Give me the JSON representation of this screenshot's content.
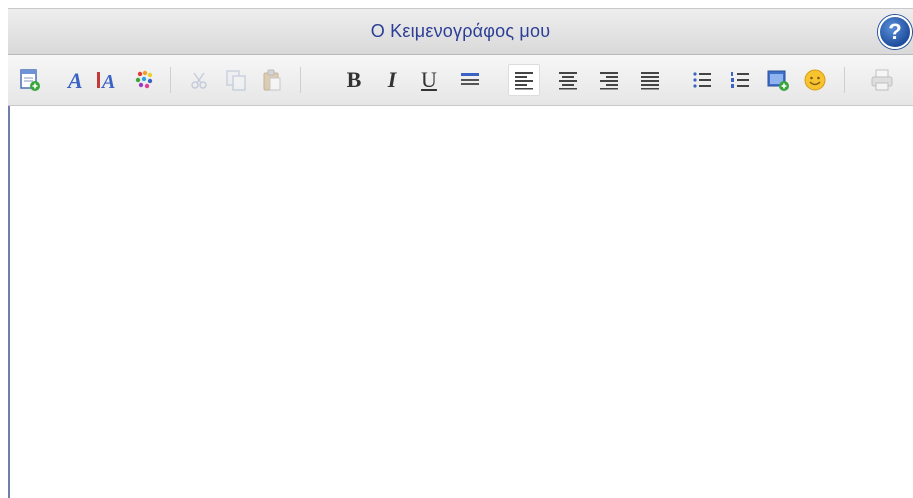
{
  "window": {
    "title": "Ο Κειμενογράφος μου",
    "help_label": "?"
  },
  "toolbar": {
    "bold_label": "B",
    "italic_label": "I",
    "underline_label": "U",
    "buttons": [
      {
        "name": "new-document",
        "icon": "new-document-icon"
      },
      {
        "name": "font",
        "icon": "font-icon"
      },
      {
        "name": "font-size",
        "icon": "font-size-icon"
      },
      {
        "name": "text-color",
        "icon": "color-palette-icon"
      },
      {
        "name": "cut",
        "icon": "scissors-icon",
        "disabled": true
      },
      {
        "name": "copy",
        "icon": "copy-icon",
        "disabled": true
      },
      {
        "name": "paste",
        "icon": "paste-icon",
        "disabled": true
      },
      {
        "name": "bold",
        "icon": "bold-icon"
      },
      {
        "name": "italic",
        "icon": "italic-icon"
      },
      {
        "name": "underline",
        "icon": "underline-icon"
      },
      {
        "name": "strikethrough",
        "icon": "strikethrough-icon"
      },
      {
        "name": "align-left",
        "icon": "align-left-icon",
        "active": true
      },
      {
        "name": "align-center",
        "icon": "align-center-icon"
      },
      {
        "name": "align-right",
        "icon": "align-right-icon"
      },
      {
        "name": "justify",
        "icon": "justify-icon"
      },
      {
        "name": "bullet-list",
        "icon": "bullet-list-icon"
      },
      {
        "name": "numbered-list",
        "icon": "numbered-list-icon"
      },
      {
        "name": "insert-image",
        "icon": "insert-image-icon"
      },
      {
        "name": "emoticon",
        "icon": "smiley-icon"
      },
      {
        "name": "print",
        "icon": "printer-icon",
        "disabled": true
      }
    ]
  },
  "colors": {
    "title": "#2c3e95",
    "accent": "#1e4f9e",
    "icon_blue": "#3a63c4",
    "icon_red": "#c43a3a",
    "icon_green": "#3aa53a"
  },
  "editor": {
    "content": ""
  }
}
